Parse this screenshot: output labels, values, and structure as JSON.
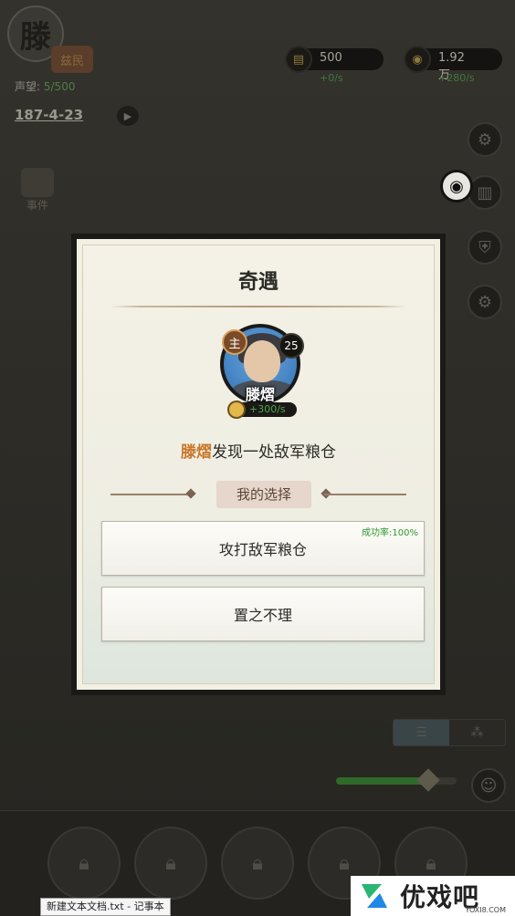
{
  "player": {
    "portrait_char": "滕",
    "rank_label": "兹民",
    "prestige_label": "声望:",
    "prestige_value": "5/500"
  },
  "date": "187-4-23",
  "resources": [
    {
      "amount": "500",
      "rate": "+0/s",
      "icon": "grain-icon"
    },
    {
      "amount": "1.92万",
      "rate": "+280/s",
      "icon": "copper-coin-icon"
    }
  ],
  "side": {
    "event_label": "事件"
  },
  "modal": {
    "title": "奇遇",
    "hero": {
      "name": "滕熠",
      "lord_badge": "主",
      "level": "25",
      "income": "+300/s"
    },
    "event_name": "滕熠",
    "event_rest": "发现一处敌军粮仓",
    "choice_header": "我的选择",
    "choices": [
      {
        "label": "攻打敌军粮仓",
        "success_rate": "成功率:100%"
      },
      {
        "label": "置之不理"
      }
    ]
  },
  "overlay": {
    "taskbar_tip": "新建文本文档.txt - 记事本",
    "watermark_text": "优戏吧",
    "watermark_url": "YOXI8.COM"
  },
  "colors": {
    "highlight": "#c9782a",
    "success": "#2f9a2f",
    "rate_green": "#3e7a3e"
  }
}
